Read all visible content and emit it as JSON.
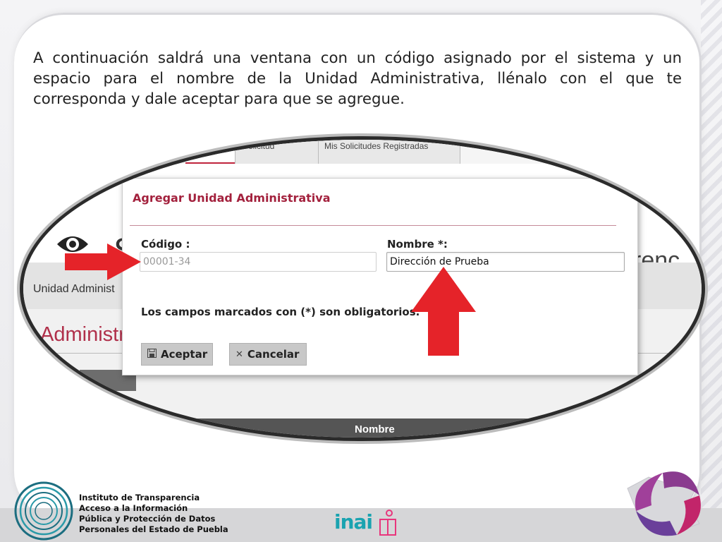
{
  "slide": {
    "instructions": "A continuación saldrá una ventana con un código asignado por el sistema y un espacio para el nombre de la Unidad Administrativa, llénalo con el que te corresponda y dale aceptar para que se agregue."
  },
  "background_page": {
    "tabs": [
      "Solicitud",
      "Mis Solicitudes Registradas"
    ],
    "header_left_letter": "S",
    "header_right_fragment": "renc",
    "breadcrumb": "Unidad Administ",
    "section_title": "Administra",
    "table_header": "Nombre"
  },
  "modal": {
    "title": "Agregar Unidad Administrativa",
    "codigo_label": "Código :",
    "codigo_value": "00001-34",
    "nombre_label": "Nombre *:",
    "nombre_value": "Dirección de Prueba",
    "required_note": "Los campos marcados con (*) son obligatorios.",
    "accept_label": "Aceptar",
    "cancel_label": "Cancelar"
  },
  "footer": {
    "institute_lines": [
      "Instituto de Transparencia",
      "Acceso a la Información",
      "Pública y Protección de Datos",
      "Personales del Estado de Puebla"
    ],
    "inai_logo_text": "inai"
  },
  "colors": {
    "accent_red": "#e52329",
    "modal_title": "#a3213d",
    "inai_teal": "#1aa3b0"
  }
}
